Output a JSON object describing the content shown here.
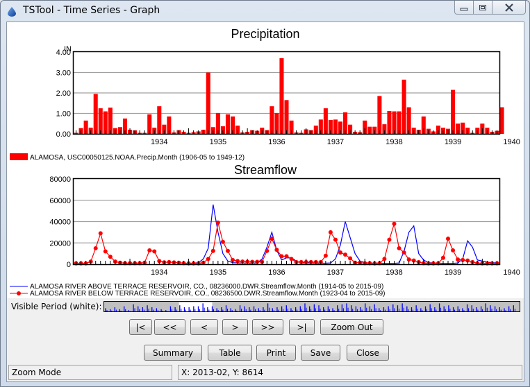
{
  "window": {
    "title": "TSTool - Time Series - Graph",
    "caption_buttons": {
      "minimize": "minimize-icon",
      "maximize": "maximize-icon",
      "close": "close-icon"
    }
  },
  "colors": {
    "precip_bar": "#ff0000",
    "flow_above": "#0000ff",
    "flow_below": "#ff0000",
    "grid": "#a0a0a0",
    "overview_bg": "#c0c0c0",
    "overview_visible": "#ffffff"
  },
  "chart_data": [
    {
      "type": "bar",
      "title": "Precipitation",
      "ylabel": "IN",
      "xlabel": "",
      "ylim": [
        0,
        4
      ],
      "yticks": [
        "0.00",
        "1.00",
        "2.00",
        "3.00",
        "4.00"
      ],
      "ytick_values": [
        0,
        1,
        2,
        3,
        4
      ],
      "grid": true,
      "x_start": "1933-02",
      "x_end": "1940-04",
      "xticks": [
        "1934",
        "1935",
        "1936",
        "1937",
        "1938",
        "1939",
        "1940"
      ],
      "legend_position": "bottom-left",
      "series": [
        {
          "name": "ALAMOSA, USC00050125.NOAA.Precip.Month (1906-05 to 1949-12)",
          "start": "1933-02",
          "values": [
            0.05,
            0.28,
            0.65,
            0.3,
            1.95,
            1.25,
            1.1,
            1.28,
            0.28,
            0.33,
            0.75,
            0.2,
            0.17,
            0.05,
            0.05,
            0.95,
            0.3,
            1.35,
            0.45,
            0.85,
            0.0,
            0.18,
            0.1,
            0.05,
            0.08,
            0.12,
            0.2,
            3.0,
            0.33,
            1.02,
            0.37,
            0.95,
            0.85,
            0.4,
            0.0,
            0.1,
            0.18,
            0.15,
            0.3,
            0.18,
            1.35,
            1.02,
            3.7,
            1.65,
            0.65,
            0.0,
            0.05,
            0.22,
            0.18,
            0.4,
            0.7,
            1.25,
            0.68,
            0.7,
            0.6,
            1.05,
            0.45,
            0.1,
            0.08,
            0.65,
            0.35,
            0.35,
            1.85,
            0.47,
            1.12,
            1.1,
            1.1,
            2.65,
            1.3,
            0.3,
            0.2,
            0.85,
            0.25,
            0.12,
            0.4,
            0.3,
            0.25,
            2.15,
            0.5,
            0.55,
            0.3,
            0.05,
            0.3,
            0.5,
            0.3,
            0.1,
            0.15,
            1.3
          ]
        }
      ]
    },
    {
      "type": "line",
      "title": "Streamflow",
      "ylabel": "",
      "xlabel": "",
      "ylim": [
        0,
        80000
      ],
      "yticks": [
        "0",
        "20000",
        "40000",
        "60000",
        "80000"
      ],
      "ytick_values": [
        0,
        20000,
        40000,
        60000,
        80000
      ],
      "grid": true,
      "x_start": "1933-02",
      "x_end": "1940-04",
      "xticks": [
        "1934",
        "1935",
        "1936",
        "1937",
        "1938",
        "1939",
        "1940"
      ],
      "legend_position": "bottom-left",
      "series": [
        {
          "name": "ALAMOSA RIVER ABOVE TERRACE RESERVOIR, CO., 08236000.DWR.Streamflow.Month (1914-05 to 2015-09)",
          "start": "1934-12",
          "marker": "none",
          "values": [
            900,
            900,
            900,
            1500,
            5000,
            15000,
            56000,
            30000,
            10000,
            3000,
            1500,
            1200,
            1100,
            1000,
            1000,
            1200,
            5000,
            16000,
            30000,
            13000,
            4000,
            6000,
            6000,
            3000,
            1200,
            1200,
            1200,
            1000,
            1000,
            1000,
            1200,
            5000,
            18000,
            40000,
            25000,
            10000,
            3000,
            1500,
            1100,
            1000,
            1000,
            800,
            800,
            800,
            1200,
            12000,
            30000,
            36000,
            10000,
            4000,
            1500,
            1100,
            1000,
            800,
            800,
            800,
            1200,
            5000,
            22000,
            16000,
            4000,
            3000,
            2000,
            1500,
            1200,
            1000,
            800,
            800,
            800,
            1200,
            5000,
            17000
          ]
        },
        {
          "name": "ALAMOSA RIVER BELOW TERRACE RESERVOIR, CO., 08236500.DWR.Streamflow.Month (1923-04 to 2015-09)",
          "start": "1933-02",
          "marker": "circle",
          "values": [
            800,
            800,
            800,
            2500,
            15000,
            29000,
            12000,
            7000,
            2500,
            1500,
            1000,
            1000,
            1000,
            1000,
            1500,
            13000,
            12000,
            3000,
            1800,
            2000,
            1700,
            1500,
            1000,
            800,
            800,
            800,
            1500,
            5000,
            12500,
            39000,
            21000,
            12500,
            4000,
            3000,
            2500,
            2300,
            2300,
            2300,
            2300,
            12500,
            24000,
            13500,
            7500,
            7500,
            5000,
            2000,
            2000,
            2000,
            2000,
            2000,
            2000,
            8000,
            30000,
            23000,
            11000,
            9000,
            5500,
            1500,
            1500,
            1000,
            1000,
            800,
            1000,
            5000,
            23000,
            38000,
            15000,
            11000,
            4500,
            3500,
            2000,
            1000,
            800,
            800,
            900,
            6000,
            24000,
            13000,
            4500,
            4000,
            3500,
            2000,
            1000,
            800,
            800,
            800,
            900,
            5000,
            18000
          ]
        }
      ]
    }
  ],
  "overview": {
    "label": "Visible Period (white):",
    "visible_start_fraction": 0.18,
    "visible_end_fraction": 0.26,
    "spikes": [
      0.4,
      0.3,
      0.5,
      0.3,
      0.6,
      0.2,
      0.8,
      0.6,
      0.5,
      0.7,
      0.5,
      0.4,
      0.3,
      0.2,
      0.6,
      0.5,
      0.7,
      0.5,
      0.5,
      0.6,
      0.6,
      0.9,
      0.5,
      0.6,
      0.4,
      0.5,
      0.7,
      0.4,
      0.3,
      0.7,
      0.6,
      0.5,
      0.6,
      0.4,
      0.5,
      0.9,
      0.4,
      0.5,
      0.6,
      0.7,
      0.4,
      0.5,
      0.6,
      0.9,
      0.6,
      0.8,
      0.7,
      0.5,
      0.6,
      0.4,
      0.7,
      0.8,
      0.9,
      0.7,
      0.6,
      0.5,
      0.9,
      0.6,
      0.8,
      0.4,
      0.5,
      0.6,
      0.8,
      0.7,
      0.9,
      0.6,
      0.5,
      0.7,
      0.4,
      0.6,
      0.8,
      0.5,
      0.9,
      0.6,
      0.7,
      0.5,
      0.6,
      0.4,
      0.8,
      0.7,
      0.5,
      0.6,
      0.9,
      0.7,
      0.6,
      0.5,
      0.4,
      0.6,
      0.7
    ]
  },
  "nav_buttons": [
    {
      "name": "first-button",
      "label": "|<"
    },
    {
      "name": "page-back-button",
      "label": "<<"
    },
    {
      "name": "back-button",
      "label": "<"
    },
    {
      "name": "forward-button",
      "label": ">"
    },
    {
      "name": "page-forward-button",
      "label": ">>"
    },
    {
      "name": "last-button",
      "label": ">|"
    },
    {
      "name": "zoom-out-button",
      "label": "Zoom Out"
    }
  ],
  "action_buttons": [
    {
      "name": "summary-button",
      "label": "Summary"
    },
    {
      "name": "table-button",
      "label": "Table"
    },
    {
      "name": "print-button",
      "label": "Print"
    },
    {
      "name": "save-button",
      "label": "Save"
    },
    {
      "name": "close-button",
      "label": "Close"
    }
  ],
  "status": {
    "mode": "Zoom Mode",
    "coords": "X:  2013-02,  Y:  8614"
  }
}
